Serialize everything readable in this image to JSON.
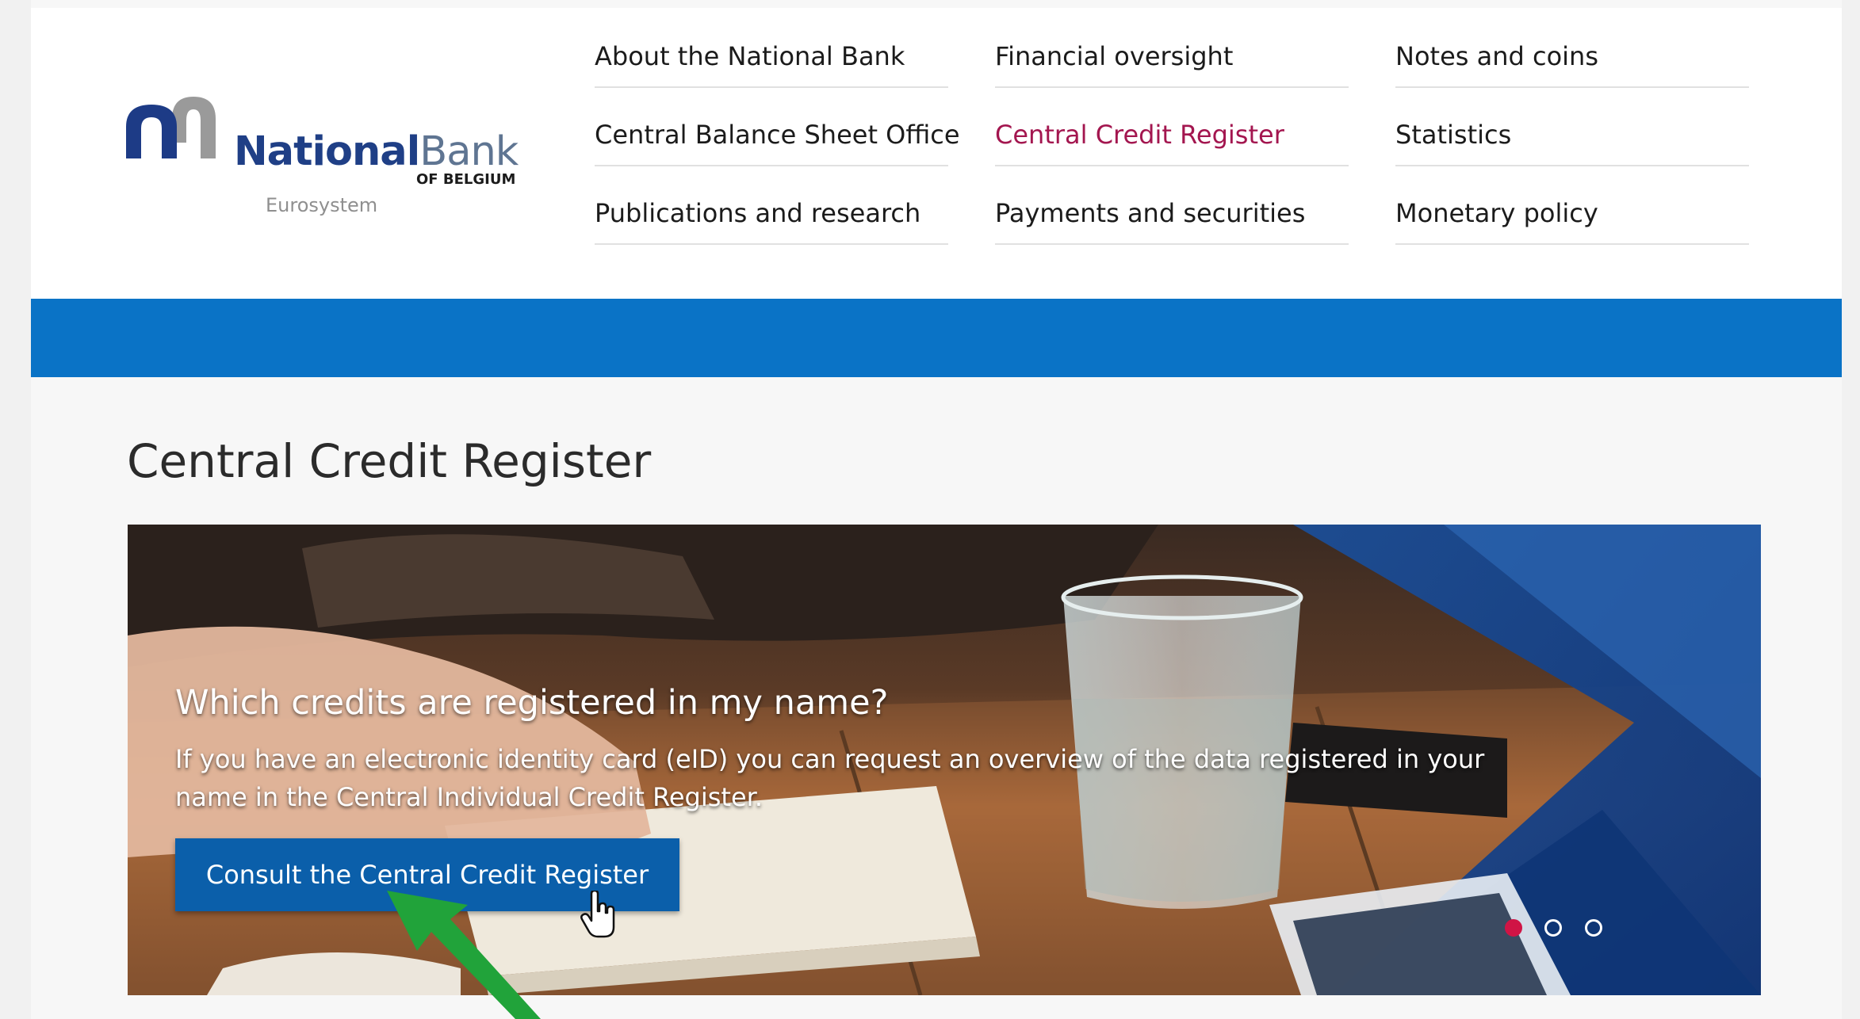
{
  "logo": {
    "name_bold": "National",
    "name_light": "Bank",
    "subtitle": "OF BELGIUM",
    "tagline": "Eurosystem"
  },
  "nav": {
    "columns": [
      [
        {
          "label": "About the National Bank"
        },
        {
          "label": "Central Balance Sheet Office"
        },
        {
          "label": "Publications and research"
        }
      ],
      [
        {
          "label": "Financial oversight"
        },
        {
          "label": "Central Credit Register"
        },
        {
          "label": "Payments and securities"
        }
      ],
      [
        {
          "label": "Notes and coins"
        },
        {
          "label": "Statistics"
        },
        {
          "label": "Monetary policy"
        }
      ]
    ],
    "active": "Central Credit Register"
  },
  "page": {
    "title": "Central Credit Register"
  },
  "hero": {
    "heading": "Which credits are registered in my name?",
    "text": "If you have an electronic identity card (eID) you can request an overview of the data registered in your name in the Central Individual Credit Register.",
    "button_label": "Consult the Central Credit Register",
    "slides_total": 3,
    "active_slide": 1
  },
  "colors": {
    "brand_blue": "#0a73c6",
    "button_blue": "#0b5faa",
    "active_nav": "#a3164f",
    "dot_active": "#d01445",
    "annotation_arrow": "#21a33a"
  },
  "icons": {
    "cursor": "hand-pointer-icon",
    "annotation": "green-arrow-icon"
  }
}
